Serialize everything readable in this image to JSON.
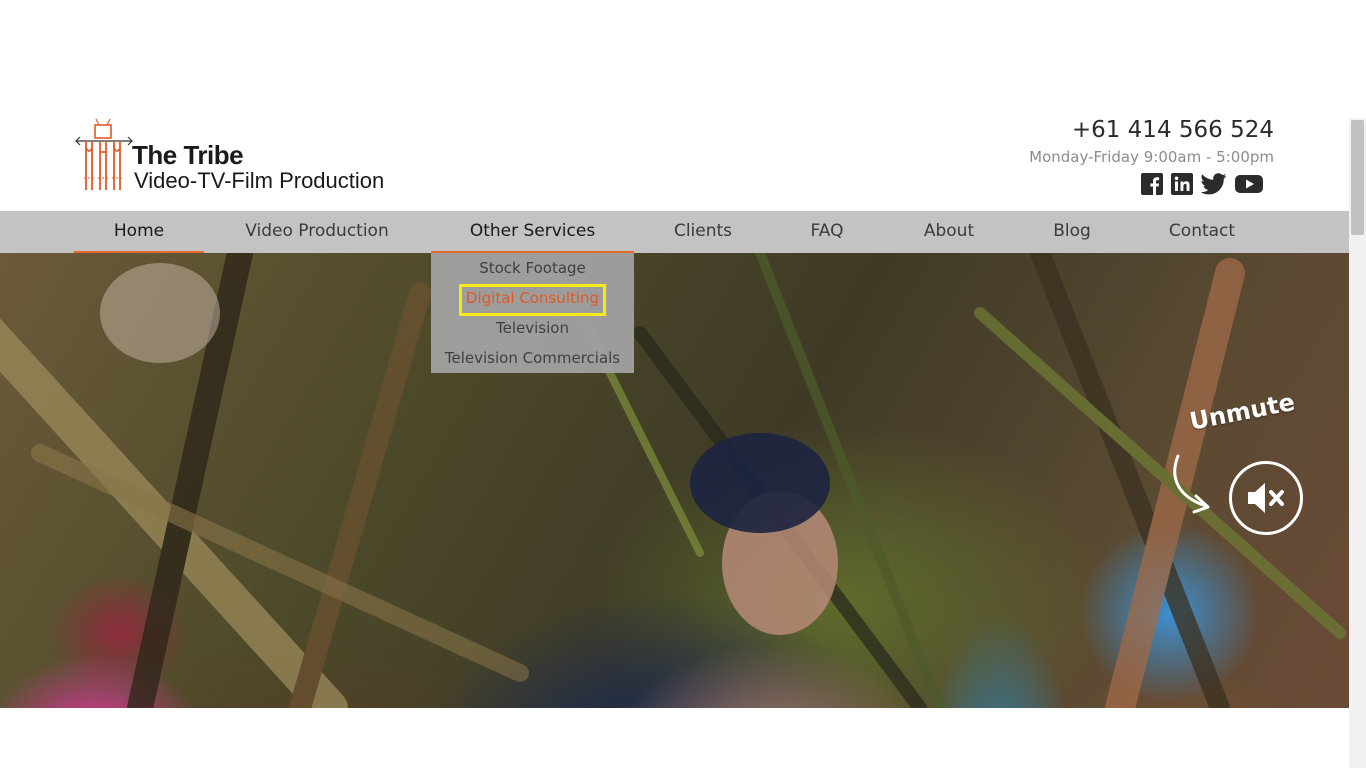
{
  "header": {
    "logo": {
      "title": "The Tribe",
      "subtitle": "Video-TV-Film Production"
    },
    "phone": "+61 414 566 524",
    "hours": "Monday-Friday  9:00am - 5:00pm",
    "social_icons": [
      "facebook-icon",
      "linkedin-icon",
      "twitter-icon",
      "youtube-icon"
    ]
  },
  "nav": {
    "items": [
      {
        "label": "Home",
        "state": "active"
      },
      {
        "label": "Video Production"
      },
      {
        "label": "Other Services",
        "state": "open"
      },
      {
        "label": "Clients"
      },
      {
        "label": "FAQ"
      },
      {
        "label": "About"
      },
      {
        "label": "Blog"
      },
      {
        "label": "Contact"
      }
    ]
  },
  "dropdown": {
    "items": [
      {
        "label": "Stock Footage"
      },
      {
        "label": "Digital Consulting",
        "state": "highlighted"
      },
      {
        "label": "Television"
      },
      {
        "label": "Television Commercials"
      }
    ]
  },
  "hero": {
    "unmute_label": "Unmute",
    "mute_icon": "speaker-muted-icon"
  },
  "colors": {
    "accent": "#e56a2e",
    "highlight_text": "#e0592a",
    "highlight_box": "#f4e816",
    "nav_bg": "#c3c3c3",
    "dropdown_bg": "#a0a0a0"
  }
}
